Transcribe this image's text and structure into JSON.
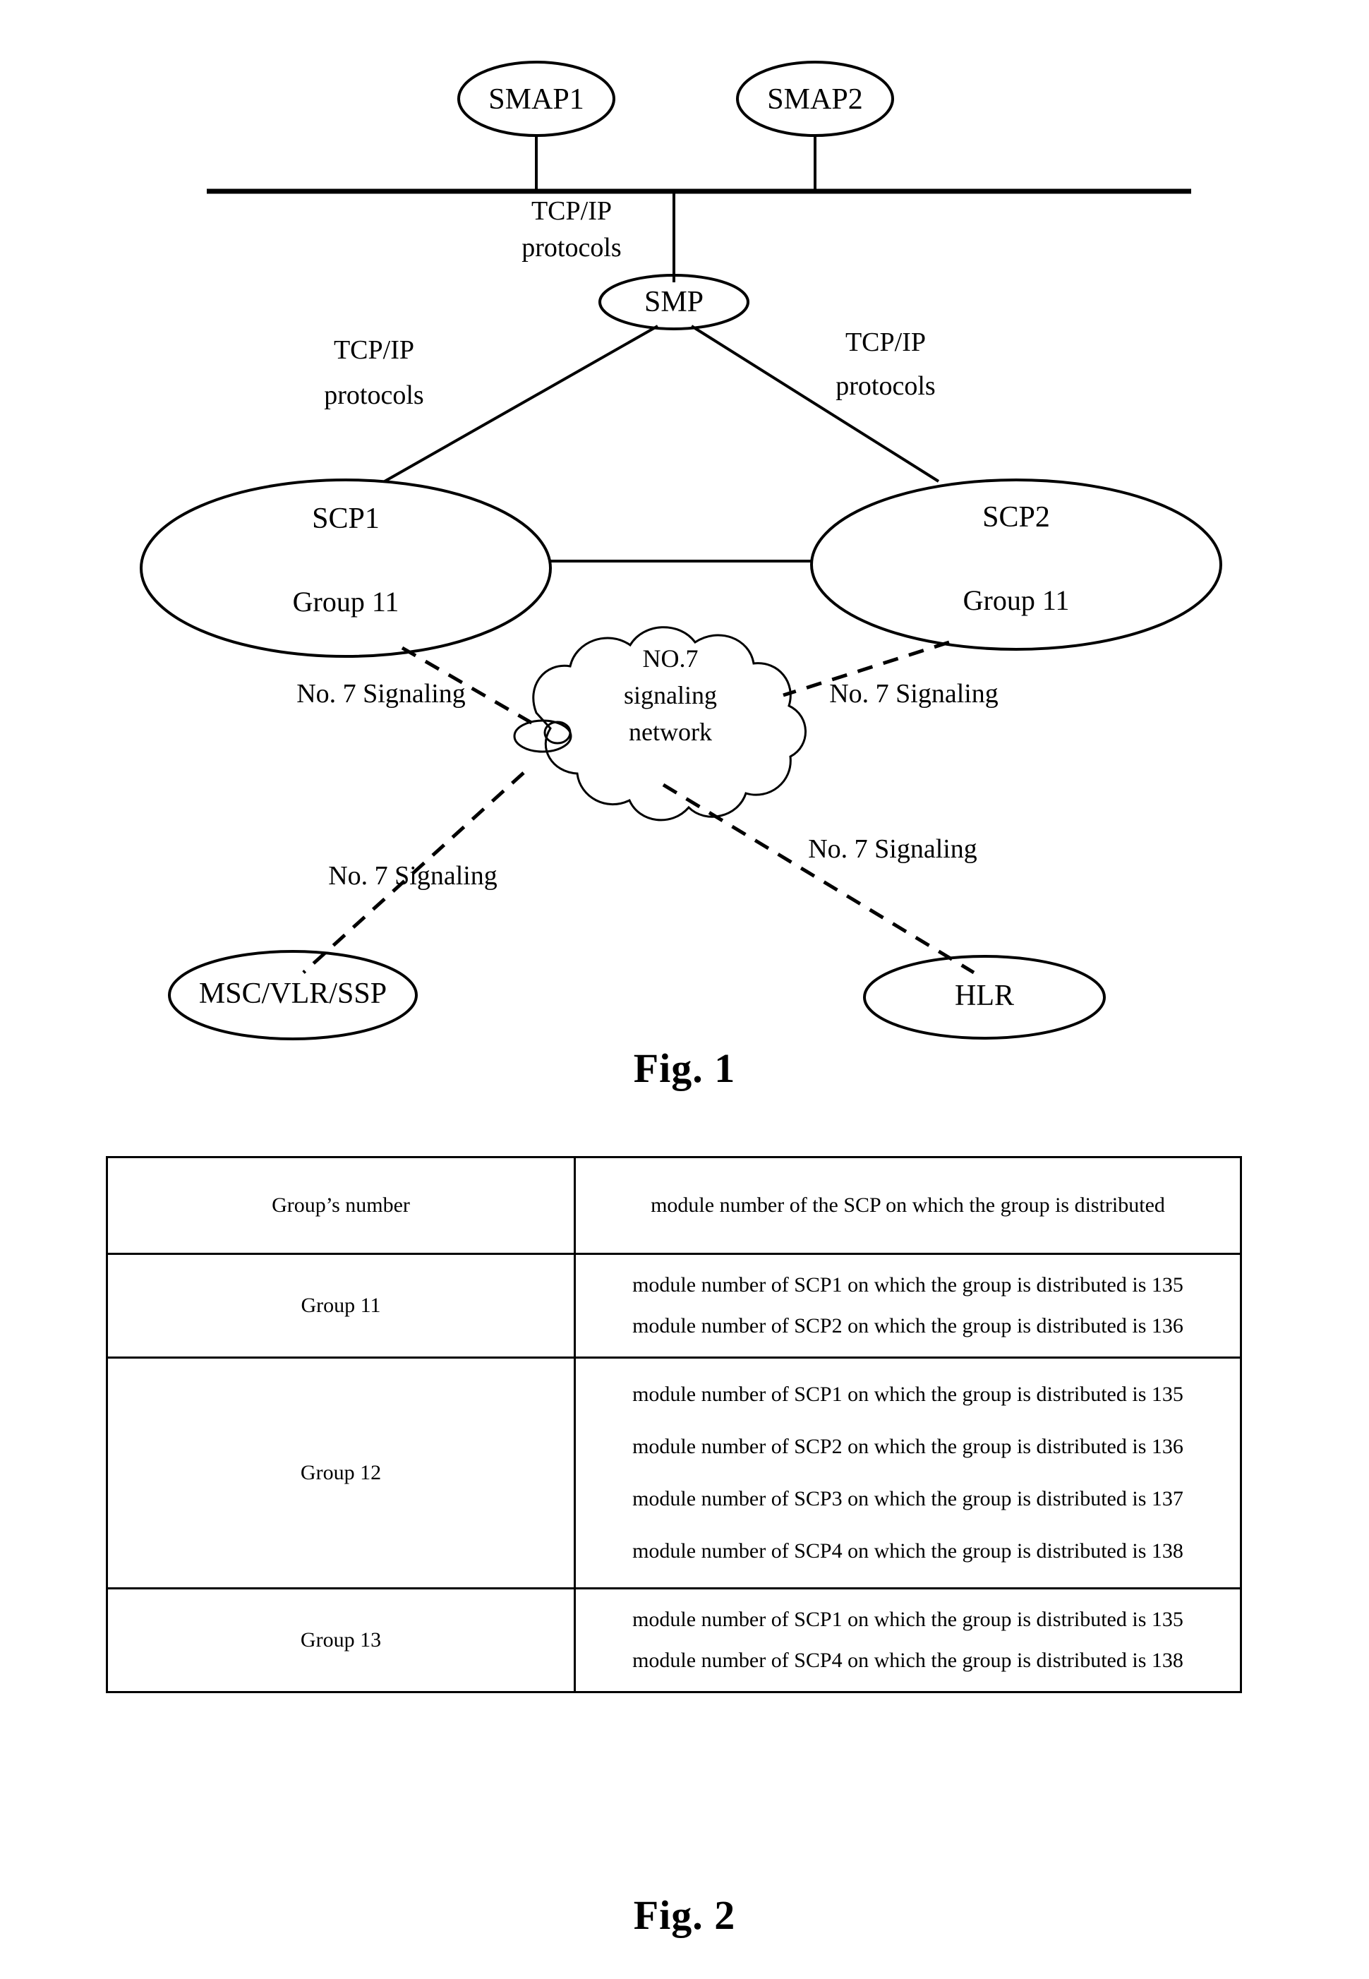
{
  "figure1": {
    "caption": "Fig. 1",
    "nodes": {
      "smap1": "SMAP1",
      "smap2": "SMAP2",
      "smp": "SMP",
      "scp1_title": "SCP1",
      "scp1_group": "Group 11",
      "scp2_title": "SCP2",
      "scp2_group": "Group 11",
      "msc": "MSC/VLR/SSP",
      "hlr": "HLR"
    },
    "cloud": {
      "line1": "NO.7",
      "line2": "signaling",
      "line3": "network"
    },
    "link_labels": {
      "bus_tcpip_line1": "TCP/IP",
      "bus_tcpip_line2": "protocols",
      "left_tcpip_line1": "TCP/IP",
      "left_tcpip_line2": "protocols",
      "right_tcpip_line1": "TCP/IP",
      "right_tcpip_line2": "protocols",
      "scp1_no7": "No. 7 Signaling",
      "scp2_no7": "No. 7 Signaling",
      "msc_no7": "No. 7 Signaling",
      "hlr_no7": "No. 7 Signaling"
    }
  },
  "figure2": {
    "caption": "Fig. 2",
    "table": {
      "headers": {
        "col1": "Group’s number",
        "col2": "module number of the SCP on which the group is distributed"
      },
      "rows": [
        {
          "group": "Group 11",
          "modules": [
            "module number of SCP1 on which the group is distributed is 135",
            "module number of SCP2 on which the group is distributed is 136"
          ]
        },
        {
          "group": "Group 12",
          "modules": [
            "module number of SCP1 on which the group is distributed is 135",
            "module number of SCP2 on which the group is distributed is 136",
            "module number of SCP3 on which the group is distributed is 137",
            "module number of SCP4 on which the group is distributed is 138"
          ]
        },
        {
          "group": "Group 13",
          "modules": [
            "module number of SCP1 on which the group is distributed is 135",
            "module number of SCP4 on which the group is distributed is 138"
          ]
        }
      ]
    }
  }
}
